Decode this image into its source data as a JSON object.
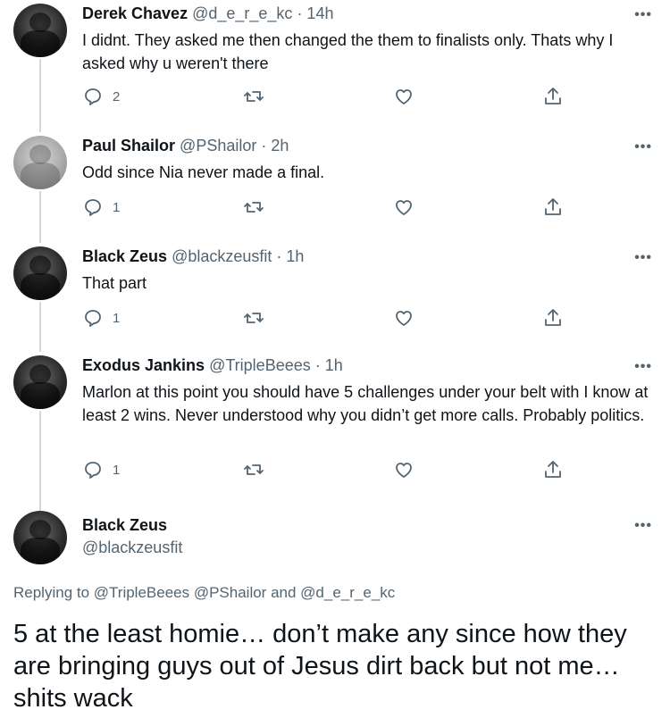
{
  "tweets": [
    {
      "name": "Derek Chavez",
      "handle": "@d_e_r_e_kc",
      "time": " · 14h",
      "text": "I didnt. They asked me then changed the them to finalists only. Thats why I asked why u weren't there",
      "replies": "2",
      "retweets": "",
      "likes": ""
    },
    {
      "name": "Paul Shailor",
      "handle": "@PShailor",
      "time": " · 2h",
      "text": "Odd since Nia never made a final.",
      "replies": "1",
      "retweets": "",
      "likes": ""
    },
    {
      "name": "Black Zeus",
      "handle": "@blackzeusfit",
      "time": " · 1h",
      "text": "That part",
      "replies": "1",
      "retweets": "",
      "likes": ""
    },
    {
      "name": "Exodus Jankins",
      "handle": "@TripleBeees",
      "time": " · 1h",
      "text": "Marlon at this point you should have 5 challenges under your belt with I know at least 2 wins. Never understood why you didn’t get more calls. Probably politics.",
      "replies": "1",
      "retweets": "",
      "likes": ""
    }
  ],
  "main_tweet": {
    "name": "Black Zeus",
    "handle": "@blackzeusfit",
    "replying_to": "Replying to @TripleBeees @PShailor and @d_e_r_e_kc",
    "text": "5 at the least homie… don’t make any since how they are bringing guys out of Jesus dirt back but not me… shits wack"
  },
  "more_label": "•••",
  "icons": {
    "reply": "reply-icon",
    "retweet": "retweet-icon",
    "like": "heart-icon",
    "share": "share-icon",
    "more": "more-icon"
  },
  "colors": {
    "text": "#0f1419",
    "secondary": "#536471",
    "thread_line": "#cfd9de"
  }
}
